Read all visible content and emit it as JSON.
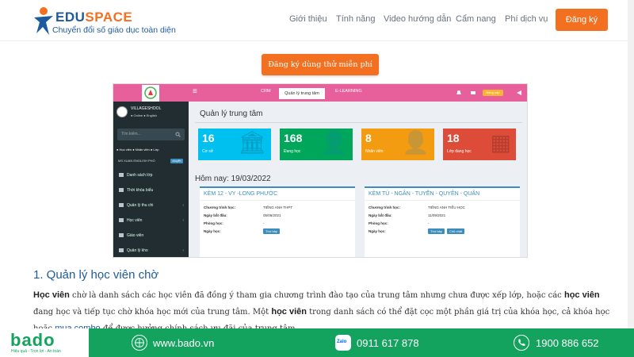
{
  "nav": {
    "logo_title_a": "EDU",
    "logo_title_b": "SPACE",
    "logo_subtitle": "Chuyển đổi số giáo dục toàn diện",
    "menu": [
      "Giới thiệu",
      "Tính năng",
      "Video hướng dẫn",
      "Cẩm nang",
      "Phí dịch vụ"
    ],
    "signup_label": "Đăng ký"
  },
  "cta_label": "Đăng ký dùng thử miễn phí",
  "screenshot": {
    "tabs": [
      "CRM",
      "Quản lý trung tâm",
      "E-LEARNING"
    ],
    "top_button": "Nâng cấp",
    "user_name": "VILLAGESHOOL",
    "user_status": "● Online  ● English",
    "search_placeholder": "Tìm kiếm...",
    "radios": "● Học viên  ● Nhân viên  ● Lớp",
    "school": "MS XUAN ENGLISH PHỔ",
    "school_badge": "chuyển",
    "sidebar_items": [
      {
        "label": "Danh sách lớp",
        "chevron": ""
      },
      {
        "label": "Thời khóa biểu",
        "chevron": ""
      },
      {
        "label": "Quản lý thu chi",
        "chevron": "‹"
      },
      {
        "label": "Học viên",
        "chevron": "‹"
      },
      {
        "label": "Giáo viên",
        "chevron": ""
      },
      {
        "label": "Quản lý kho",
        "chevron": "‹"
      }
    ],
    "page_title": "Quản lý trung tâm",
    "stats": [
      {
        "value": "16",
        "label": "Cơ sở",
        "color": "#00c0ef",
        "icon": "🏛"
      },
      {
        "value": "168",
        "label": "Đang học",
        "color": "#00a65a",
        "icon": "👤"
      },
      {
        "value": "8",
        "label": "Nhân viên",
        "color": "#f39c12",
        "icon": "👤"
      },
      {
        "value": "18",
        "label": "Lớp đang học",
        "color": "#dd4b39",
        "icon": "▦"
      }
    ],
    "today": "Hôm nay: 19/03/2022",
    "cards": [
      {
        "title": "KÈM 12 - VY -LONG PHƯỚC",
        "program_label": "Chương trình học:",
        "program": "TIẾNG ANH THPT",
        "start_label": "Ngày bắt đầu:",
        "start": "05/06/2021",
        "room_label": "Phòng học:",
        "room": "-",
        "days_label": "Ngày học:",
        "days": [
          "Thứ bảy"
        ]
      },
      {
        "title": "KÈM TÚ - NGÂN - TUYỀN - QUYÊN - QUÂN",
        "program_label": "Chương trình học:",
        "program": "TIẾNG ANH TIỂU HỌC",
        "start_label": "Ngày bắt đầu:",
        "start": "11/09/2021",
        "room_label": "Phòng học:",
        "room": "-",
        "days_label": "Ngày học:",
        "days": [
          "Thứ bảy",
          "Chủ nhật"
        ]
      }
    ]
  },
  "article": {
    "heading": "1. Quản lý học viên chờ",
    "p1": "Học viên",
    "p2": " chờ là danh sách các học viên đã đồng ý tham gia chương trình đào tạo của trung tâm nhưng chưa được xếp lớp, hoặc các ",
    "p3": "học viên",
    "p4": " đang học và tiếp tục chờ khóa học mới của trung tâm. Một ",
    "p5": "học viên",
    "p6": " trong danh sách có thể đặt cọc một phần giá trị của khóa học, cả khóa học hoặc ",
    "p7": "mua combo",
    "p8": " để được hưởng chính sách ưu đãi của trung tâm."
  },
  "footer": {
    "brand": "bado",
    "tagline": "Hiệu quả - Trọn lợi - An toàn",
    "website": "www.bado.vn",
    "zalo_label": "Zalo",
    "zalo_phone": "0911 617 878",
    "hotline": "1900 886 652"
  },
  "colors": {
    "accent": "#f37021",
    "brand": "#1d5a9e",
    "footer": "#14a35e",
    "topbar": "#e8609b"
  }
}
